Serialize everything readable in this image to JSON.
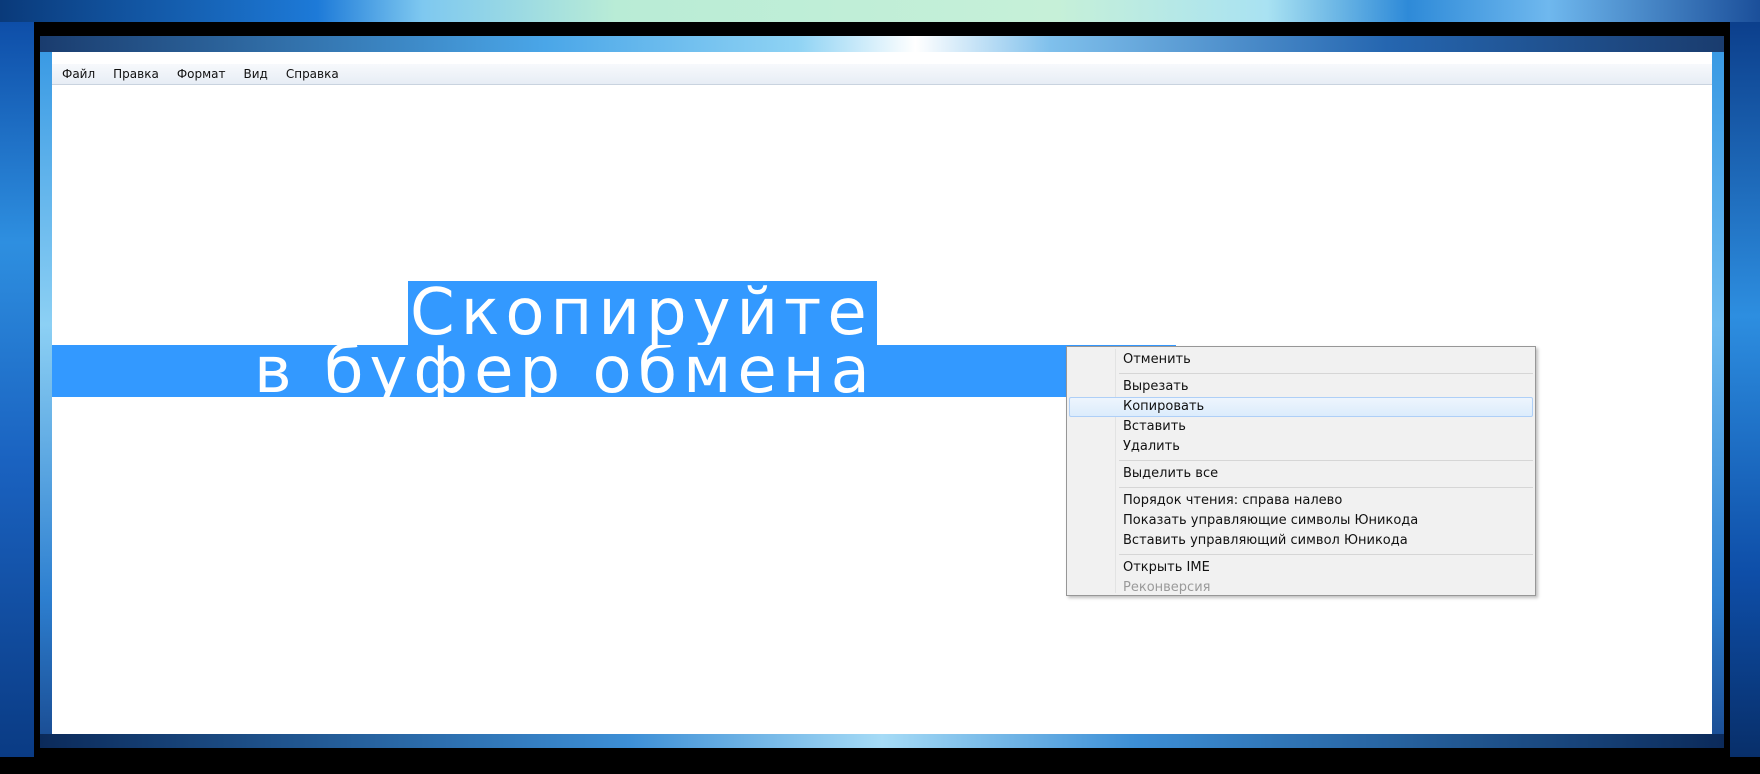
{
  "menubar": {
    "items": [
      {
        "label": "Файл"
      },
      {
        "label": "Правка"
      },
      {
        "label": "Формат"
      },
      {
        "label": "Вид"
      },
      {
        "label": "Справка"
      }
    ]
  },
  "editor": {
    "line1": "Скопируйте",
    "line2": "в буфер обмена",
    "selection_color": "#3399ff"
  },
  "context_menu": {
    "undo": "Отменить",
    "cut": "Вырезать",
    "copy": "Копировать",
    "paste": "Вставить",
    "delete": "Удалить",
    "select_all": "Выделить все",
    "rtl_order": "Порядок чтения: справа налево",
    "show_unicode": "Показать управляющие символы Юникода",
    "insert_unicode": "Вставить управляющий символ Юникода",
    "open_ime": "Открыть IME",
    "reconversion": "Реконверсия",
    "hovered_item": "Копировать"
  }
}
